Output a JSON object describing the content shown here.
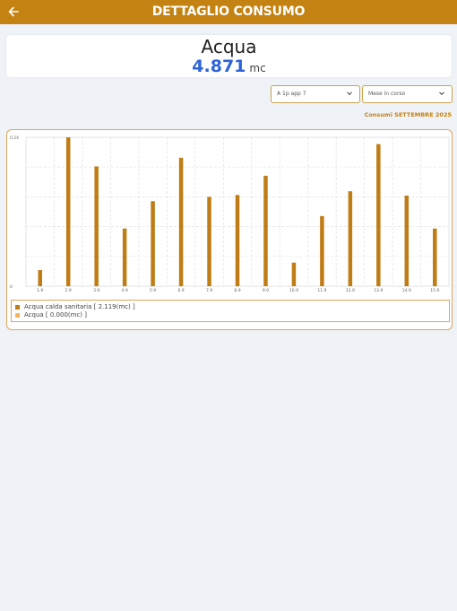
{
  "header": {
    "title": "DETTAGLIO CONSUMO",
    "back_icon": "arrow-left-icon"
  },
  "summary": {
    "name": "Acqua",
    "value": "4.871",
    "unit": "mc"
  },
  "filters": {
    "apartment": "A 1p app 7",
    "period": "Mese in corso",
    "chevron_icon": "chevron-down-icon"
  },
  "period_label": "Consumi SETTEMBRE 2025",
  "colors": {
    "accent": "#c48212",
    "value": "#2c63d8",
    "series_hot": "#c07d16",
    "series_water": "#f4b55a"
  },
  "chart_data": {
    "type": "bar",
    "categories": [
      "1.9",
      "2.9",
      "3.9",
      "4.9",
      "5.9",
      "6.9",
      "7.9",
      "8.9",
      "9.9",
      "10.9",
      "11.9",
      "12.9",
      "13.9",
      "14.9",
      "15.9"
    ],
    "series": [
      {
        "name": "Acqua calda sanitaria",
        "values": [
          0.026,
          0.24,
          0.193,
          0.093,
          0.137,
          0.207,
          0.144,
          0.147,
          0.178,
          0.038,
          0.113,
          0.153,
          0.229,
          0.146,
          0.093
        ]
      },
      {
        "name": "Acqua",
        "values": [
          0,
          0,
          0,
          0,
          0,
          0,
          0,
          0,
          0,
          0,
          0,
          0,
          0,
          0,
          0
        ]
      }
    ],
    "ylim": [
      0,
      0.24
    ],
    "y_tick_labels": [
      "0",
      "0.24"
    ],
    "grid": true,
    "legend_placement": "bottom",
    "legend_entries": [
      "Acqua calda sanitaria [ 2.119(mc) ]",
      "Acqua [ 0.000(mc) ]"
    ]
  }
}
